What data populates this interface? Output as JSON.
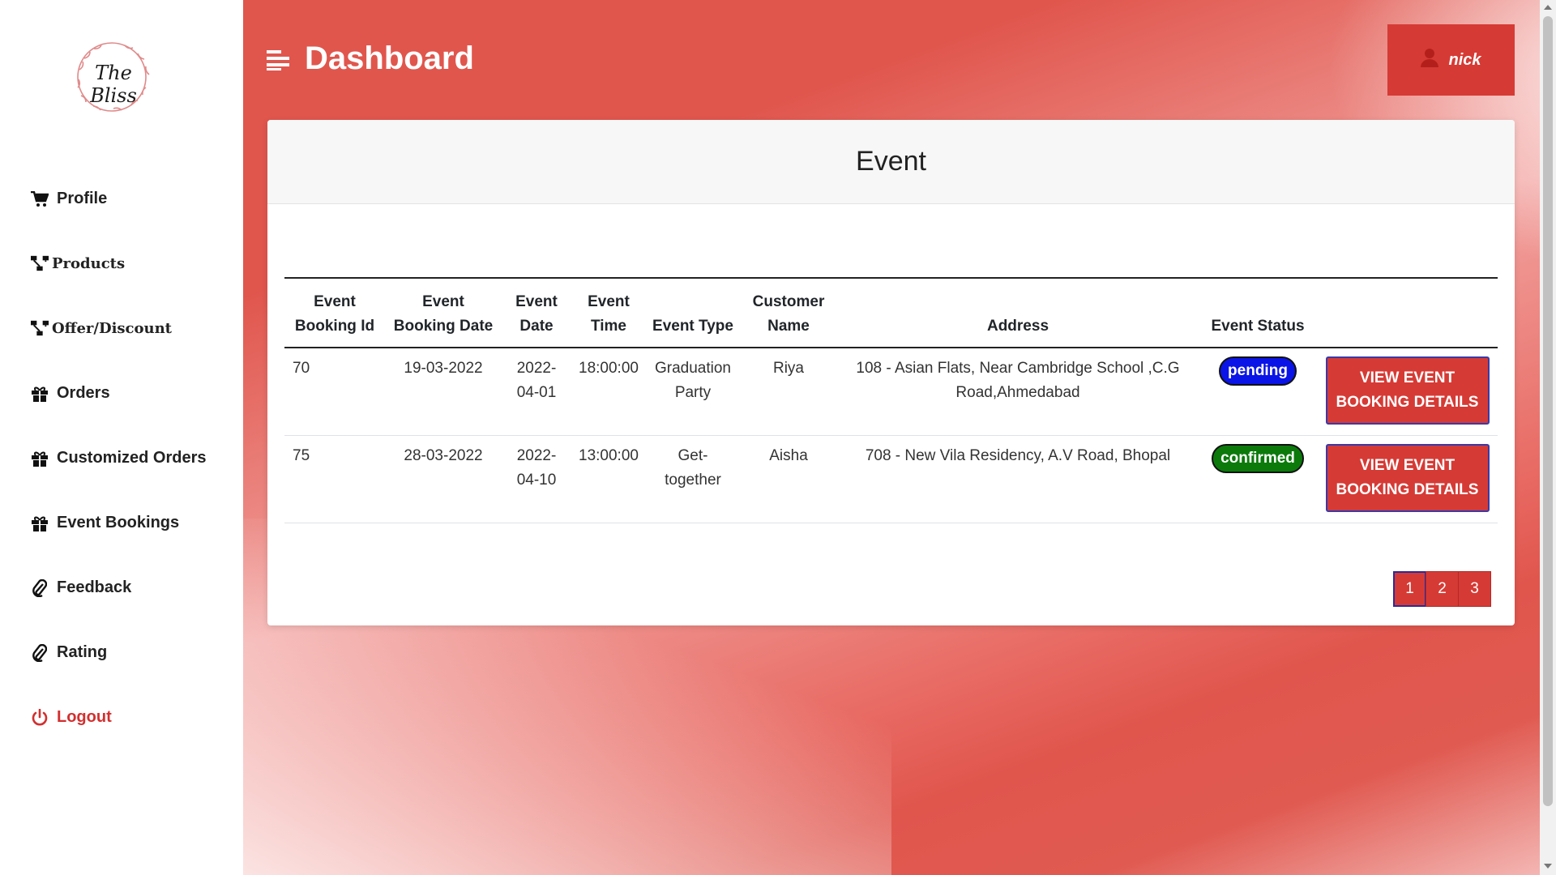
{
  "brand": {
    "logo_text": "The Bliss",
    "accent": "#d63a35"
  },
  "sidebar": {
    "items": [
      {
        "label": "Profile",
        "icon": "cart-icon"
      },
      {
        "label": "Products",
        "icon": "sitemap-icon"
      },
      {
        "label": "Offer/Discount",
        "icon": "sitemap-icon"
      },
      {
        "label": "Orders",
        "icon": "gift-icon"
      },
      {
        "label": "Customized Orders",
        "icon": "gift-icon"
      },
      {
        "label": "Event Bookings",
        "icon": "gift-icon"
      },
      {
        "label": "Feedback",
        "icon": "paperclip-icon"
      },
      {
        "label": "Rating",
        "icon": "paperclip-icon"
      },
      {
        "label": "Logout",
        "icon": "power-icon"
      }
    ]
  },
  "header": {
    "title": "Dashboard",
    "user": "nick"
  },
  "card": {
    "title": "Event"
  },
  "table": {
    "columns": [
      "Event Booking Id",
      "Event Booking Date",
      "Event Date",
      "Event Time",
      "Event Type",
      "Customer Name",
      "Address",
      "Event Status",
      ""
    ],
    "rows": [
      {
        "id": "70",
        "booking_date": "19-03-2022",
        "event_date": "2022-04-01",
        "event_time": "18:00:00",
        "event_type": "Graduation Party",
        "customer": "Riya",
        "address": "108 - Asian Flats, Near Cambridge School ,C.G Road,Ahmedabad",
        "status": "pending",
        "action": "VIEW EVENT BOOKING DETAILS"
      },
      {
        "id": "75",
        "booking_date": "28-03-2022",
        "event_date": "2022-04-10",
        "event_time": "13:00:00",
        "event_type": "Get-together",
        "customer": "Aisha",
        "address": "708 - New Vila Residency, A.V Road, Bhopal",
        "status": "confirmed",
        "action": "VIEW EVENT BOOKING DETAILS"
      }
    ]
  },
  "pagination": {
    "pages": [
      "1",
      "2",
      "3"
    ],
    "current": "1"
  }
}
